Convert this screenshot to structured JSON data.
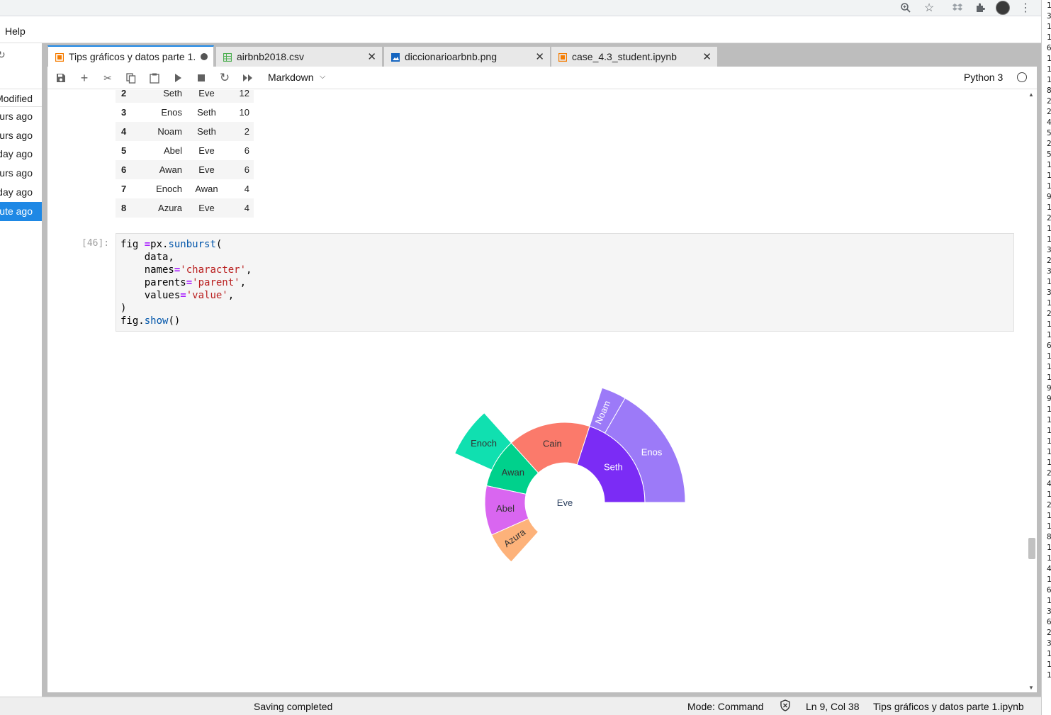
{
  "menubar": {
    "help": "Help"
  },
  "filebrowser": {
    "header": "Modified",
    "rows": [
      "urs ago",
      "urs ago",
      "day ago",
      "urs ago",
      "day ago",
      "ute ago"
    ]
  },
  "tabs": [
    {
      "label": "Tips gráficos y datos parte 1.",
      "active": true,
      "icon": "notebook-icon",
      "icon_color": "#f57c00"
    },
    {
      "label": "airbnb2018.csv",
      "active": false,
      "icon": "spreadsheet-icon",
      "icon_color": "#4caf50"
    },
    {
      "label": "diccionarioarbnb.png",
      "active": false,
      "icon": "image-icon",
      "icon_color": "#1565c0"
    },
    {
      "label": "case_4.3_student.ipynb",
      "active": false,
      "icon": "notebook-icon",
      "icon_color": "#f57c00"
    }
  ],
  "toolbar": {
    "cell_type": "Markdown",
    "kernel": "Python 3"
  },
  "dataframe": {
    "rows": [
      [
        "2",
        "Seth",
        "Eve",
        "12"
      ],
      [
        "3",
        "Enos",
        "Seth",
        "10"
      ],
      [
        "4",
        "Noam",
        "Seth",
        "2"
      ],
      [
        "5",
        "Abel",
        "Eve",
        "6"
      ],
      [
        "6",
        "Awan",
        "Eve",
        "6"
      ],
      [
        "7",
        "Enoch",
        "Awan",
        "4"
      ],
      [
        "8",
        "Azura",
        "Eve",
        "4"
      ]
    ]
  },
  "code_cell": {
    "prompt": "[46]:",
    "lines": [
      [
        "fig ",
        "=",
        "px.",
        "sunburst",
        "("
      ],
      [
        "    data,"
      ],
      [
        "    names",
        "=",
        "'character'",
        ","
      ],
      [
        "    parents",
        "=",
        "'parent'",
        ","
      ],
      [
        "    values",
        "=",
        "'value'",
        ","
      ],
      [
        ")"
      ],
      [
        "fig.",
        "show",
        "()"
      ]
    ]
  },
  "chart_data": {
    "type": "sunburst",
    "root": "Eve",
    "nodes": [
      {
        "name": "Eve",
        "parent": ""
      },
      {
        "name": "Seth",
        "parent": "Eve",
        "value": 12,
        "color": "#7b2cf5"
      },
      {
        "name": "Cain",
        "parent": "Eve",
        "value": 10,
        "color": "#fb7a6b"
      },
      {
        "name": "Awan",
        "parent": "Eve",
        "value": 6,
        "color": "#00d18c"
      },
      {
        "name": "Abel",
        "parent": "Eve",
        "value": 6,
        "color": "#d966f0"
      },
      {
        "name": "Azura",
        "parent": "Eve",
        "value": 4,
        "color": "#fdb27a"
      },
      {
        "name": "Enos",
        "parent": "Seth",
        "value": 10,
        "color": "#9c7af8"
      },
      {
        "name": "Noam",
        "parent": "Seth",
        "value": 2,
        "color": "#9c7af8"
      },
      {
        "name": "Enoch",
        "parent": "Awan",
        "value": 4,
        "color": "#10e0b0"
      }
    ]
  },
  "statusbar": {
    "saving": "Saving completed",
    "mode": "Mode: Command",
    "position": "Ln 9, Col 38",
    "filename": "Tips gráficos y datos parte 1.ipynb"
  },
  "right_strip": [
    "1",
    "3",
    "1",
    "1",
    "6",
    "1",
    "1",
    "1",
    "8",
    "2",
    "2",
    "4",
    "5",
    "2",
    "5",
    "1",
    "1",
    "1",
    "9",
    "1",
    "2",
    "1",
    "1",
    "3",
    "2",
    "3",
    "1",
    "3",
    "1",
    "2",
    "1",
    "1",
    "6",
    "1",
    "1",
    "1",
    "9",
    "9",
    "1",
    "1",
    "1",
    "1",
    "1",
    "1",
    "2",
    "4",
    "1",
    "2",
    "1",
    "1",
    "8",
    "1",
    "1",
    "4",
    "1",
    "6",
    "1",
    "3",
    "6",
    "2",
    "3",
    "1",
    "1",
    "1"
  ]
}
